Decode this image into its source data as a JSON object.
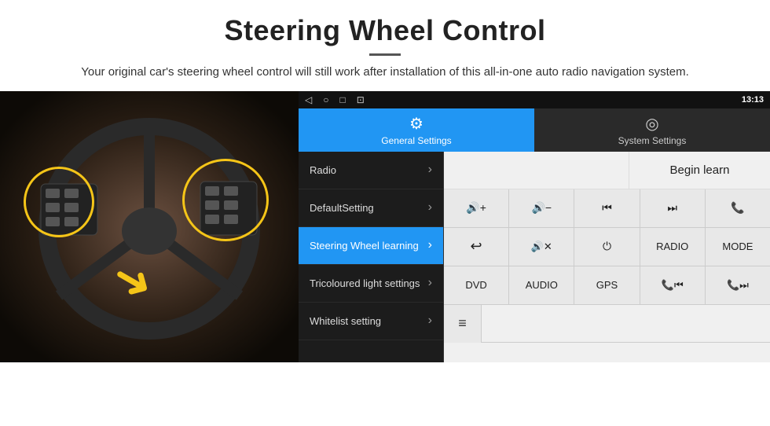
{
  "page": {
    "title": "Steering Wheel Control",
    "divider": true,
    "subtitle": "Your original car's steering wheel control will still work after installation of this all-in-one auto radio navigation system."
  },
  "status_bar": {
    "back_icon": "◁",
    "home_icon": "○",
    "recent_icon": "□",
    "screenshot_icon": "⊡",
    "signal_icon": "▾",
    "wifi_icon": "▾",
    "time": "13:13"
  },
  "tabs": [
    {
      "id": "general",
      "label": "General Settings",
      "icon": "⚙",
      "active": true
    },
    {
      "id": "system",
      "label": "System Settings",
      "icon": "◎",
      "active": false
    }
  ],
  "menu_items": [
    {
      "id": "radio",
      "label": "Radio",
      "active": false
    },
    {
      "id": "default",
      "label": "DefaultSetting",
      "active": false
    },
    {
      "id": "steering",
      "label": "Steering Wheel learning",
      "active": true
    },
    {
      "id": "tricoloured",
      "label": "Tricoloured light settings",
      "active": false
    },
    {
      "id": "whitelist",
      "label": "Whitelist setting",
      "active": false
    }
  ],
  "begin_learn_label": "Begin learn",
  "control_buttons": {
    "row1": [
      {
        "label": "🔊+",
        "id": "vol-up"
      },
      {
        "label": "🔊−",
        "id": "vol-down"
      },
      {
        "label": "⏮",
        "id": "prev"
      },
      {
        "label": "⏭",
        "id": "next"
      },
      {
        "label": "📞",
        "id": "call"
      }
    ],
    "row2": [
      {
        "label": "↩",
        "id": "back"
      },
      {
        "label": "🔇✕",
        "id": "mute"
      },
      {
        "label": "⏻",
        "id": "power"
      },
      {
        "label": "RADIO",
        "id": "radio-btn"
      },
      {
        "label": "MODE",
        "id": "mode-btn"
      }
    ],
    "row3": [
      {
        "label": "DVD",
        "id": "dvd-btn"
      },
      {
        "label": "AUDIO",
        "id": "audio-btn"
      },
      {
        "label": "GPS",
        "id": "gps-btn"
      },
      {
        "label": "📞⏮",
        "id": "tel-prev"
      },
      {
        "label": "📞⏭",
        "id": "tel-next"
      }
    ]
  },
  "bottom_row": [
    {
      "label": "≡",
      "id": "menu-icon"
    }
  ]
}
